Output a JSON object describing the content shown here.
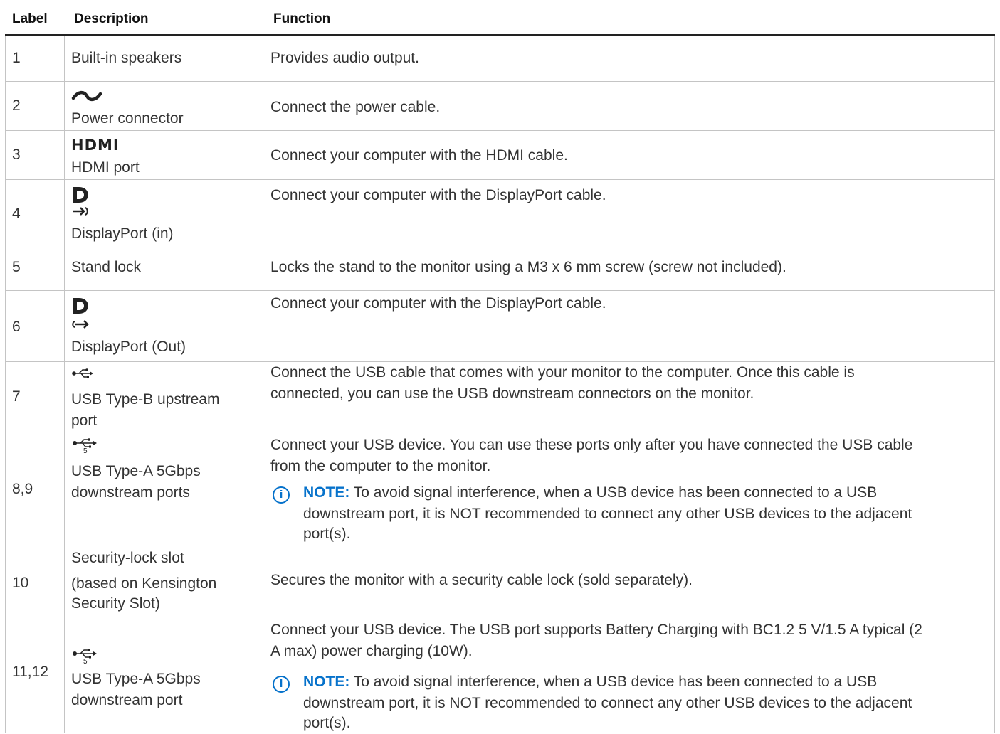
{
  "headers": {
    "label": "Label",
    "description": "Description",
    "function": "Function"
  },
  "rows": [
    {
      "label": "1",
      "description": "Built-in speakers",
      "function": "Provides audio output."
    },
    {
      "label": "2",
      "icon": "ac-power-icon",
      "description": "Power connector",
      "function": "Connect  the power cable."
    },
    {
      "label": "3",
      "icon": "hdmi-logo-icon",
      "icon_text": "HDMI",
      "description": "HDMI port",
      "function": "Connect your computer with the HDMI cable."
    },
    {
      "label": "4",
      "icon": "displayport-in-icon",
      "description": "DisplayPort (in)",
      "function": "Connect your computer with the DisplayPort cable."
    },
    {
      "label": "5",
      "description": "Stand lock",
      "function": "Locks the stand to the monitor using a M3 x 6 mm screw (screw not included)."
    },
    {
      "label": "6",
      "icon": "displayport-out-icon",
      "description": "DisplayPort (Out)",
      "function": "Connect your computer with the DisplayPort cable."
    },
    {
      "label": "7",
      "icon": "usb-icon",
      "description_l1": "USB Type-B upstream",
      "description_l2": "port",
      "function_l1": "Connect the USB cable that comes with your monitor to the computer. Once this cable is",
      "function_l2": "connected, you can use the USB downstream connectors on the monitor."
    },
    {
      "label": "8,9",
      "icon": "usb-5gbps-icon",
      "icon_text": "5",
      "description_l1": "USB Type-A 5Gbps",
      "description_l2": "downstream ports",
      "function_l1": "Connect your USB device. You can use these ports only after you have connected the USB cable",
      "function_l2": "from the computer to the monitor.",
      "note_label": "NOTE:",
      "note_l1": " To avoid signal interference, when a USB device has been connected to a USB",
      "note_l2": "downstream port, it is NOT recommended to connect any other USB devices to the adjacent",
      "note_l3": "port(s)."
    },
    {
      "label": "10",
      "description_l1": "Security-lock slot",
      "description_l2": "(based on Kensington",
      "description_l3": "Security Slot)",
      "function": "Secures the monitor with a security cable lock (sold separately)."
    },
    {
      "label": "11,12",
      "icon": "usb-5gbps-icon",
      "icon_text": "5",
      "description_l1": "USB Type-A 5Gbps",
      "description_l2": "downstream port",
      "function_l1": "Connect your USB device. The USB port supports Battery Charging with BC1.2 5 V/1.5 A typical (2",
      "function_l2": "A max) power charging (10W).",
      "note_label": "NOTE:",
      "note_l1": " To avoid signal interference, when a USB device has been connected to a USB",
      "note_l2": "downstream port, it is NOT recommended to connect any other USB devices to the adjacent",
      "note_l3": "port(s)."
    }
  ],
  "note_icon": "info-icon",
  "note_icon_glyph": "i"
}
